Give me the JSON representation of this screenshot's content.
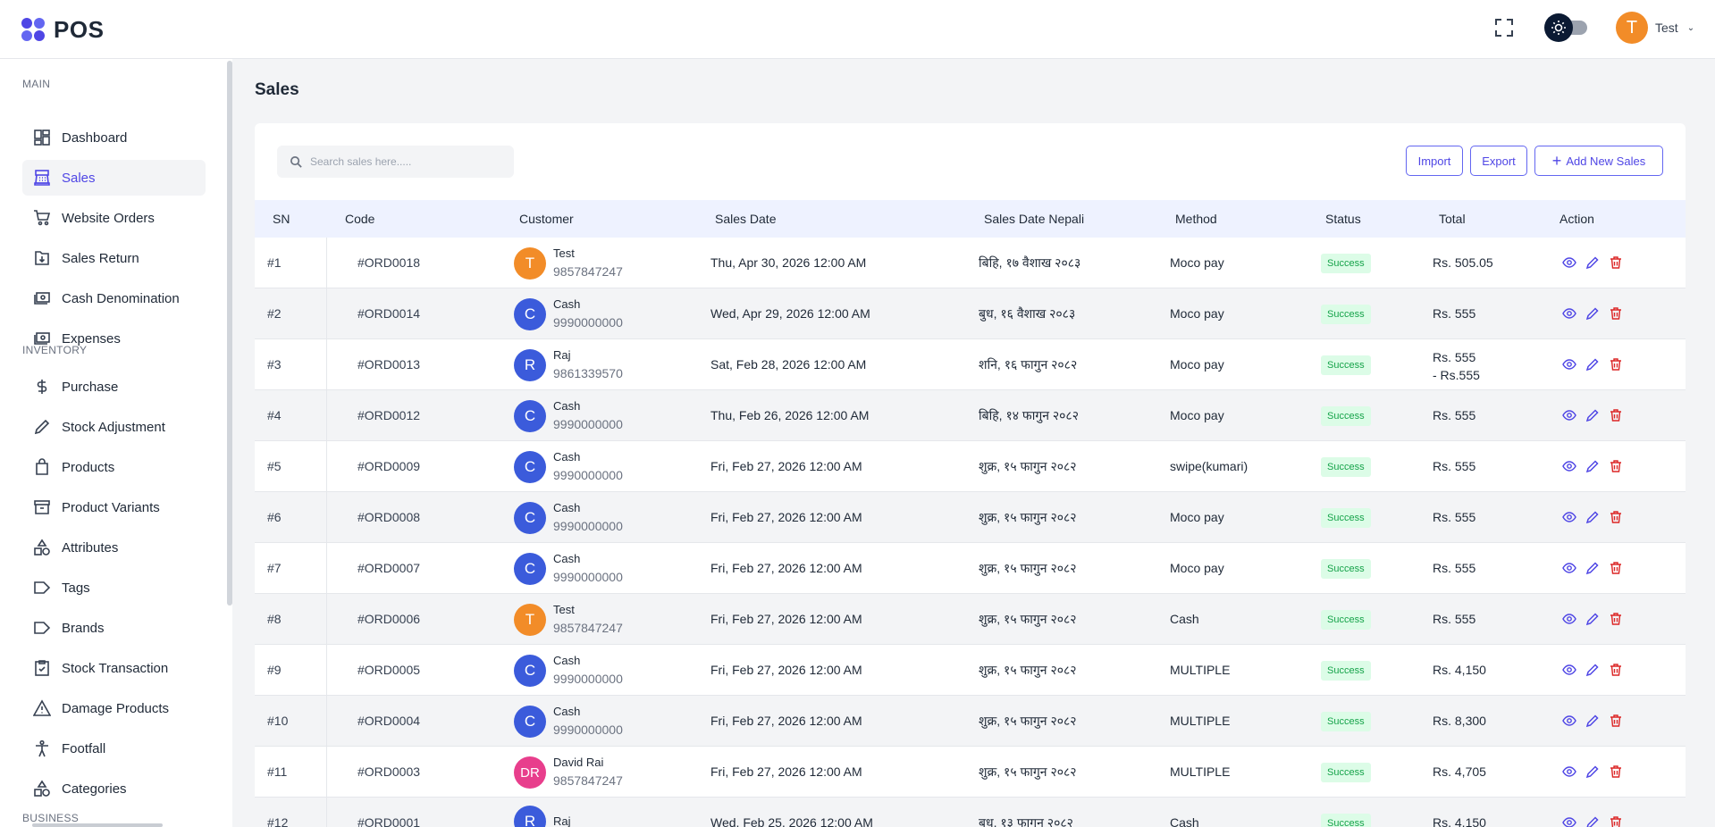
{
  "header": {
    "logo_text": "POS",
    "user_initial": "T",
    "user_name": "Test"
  },
  "sidebar": {
    "sections": {
      "main": "MAIN",
      "inventory": "INVENTORY",
      "business": "BUSINESS"
    },
    "items": [
      {
        "label": "Dashboard",
        "icon": "dashboard-icon"
      },
      {
        "label": "Sales",
        "icon": "cash-register-icon",
        "active": true
      },
      {
        "label": "Website Orders",
        "icon": "cart-icon"
      },
      {
        "label": "Sales Return",
        "icon": "return-box-icon"
      },
      {
        "label": "Cash Denomination",
        "icon": "banknote-icon"
      },
      {
        "label": "Expenses",
        "icon": "banknote-icon"
      },
      {
        "label": "Purchase",
        "icon": "dollar-icon"
      },
      {
        "label": "Stock Adjustment",
        "icon": "pencil-icon"
      },
      {
        "label": "Products",
        "icon": "shopping-bag-icon"
      },
      {
        "label": "Product Variants",
        "icon": "archive-icon"
      },
      {
        "label": "Attributes",
        "icon": "shapes-icon"
      },
      {
        "label": "Tags",
        "icon": "tag-icon"
      },
      {
        "label": "Brands",
        "icon": "tag-icon"
      },
      {
        "label": "Stock Transaction",
        "icon": "clipboard-check-icon"
      },
      {
        "label": "Damage Products",
        "icon": "warning-icon"
      },
      {
        "label": "Footfall",
        "icon": "person-icon"
      },
      {
        "label": "Categories",
        "icon": "shapes-icon"
      }
    ]
  },
  "main": {
    "title": "Sales",
    "search_placeholder": "Search sales here.....",
    "buttons": {
      "import": "Import",
      "export": "Export",
      "add": "Add New Sales"
    },
    "columns": [
      "SN",
      "Code",
      "Customer",
      "Sales Date",
      "Sales Date Nepali",
      "Method",
      "Status",
      "Total",
      "Action"
    ],
    "rows": [
      {
        "sn": "#1",
        "code": "#ORD0018",
        "initial": "T",
        "avatar_color": "#f28c28",
        "name": "Test",
        "phone": "9857847247",
        "date": "Thu, Apr 30, 2026 12:00 AM",
        "nepali": "बिहि, १७ वैशाख २०८३",
        "method": "Moco pay",
        "status": "Success",
        "total": "Rs. 505.05",
        "total2": ""
      },
      {
        "sn": "#2",
        "code": "#ORD0014",
        "initial": "C",
        "avatar_color": "#3b5bdb",
        "name": "Cash",
        "phone": "9990000000",
        "date": "Wed, Apr 29, 2026 12:00 AM",
        "nepali": "बुध, १६ वैशाख २०८३",
        "method": "Moco pay",
        "status": "Success",
        "total": "Rs. 555",
        "total2": ""
      },
      {
        "sn": "#3",
        "code": "#ORD0013",
        "initial": "R",
        "avatar_color": "#3b5bdb",
        "name": "Raj",
        "phone": "9861339570",
        "date": "Sat, Feb 28, 2026 12:00 AM",
        "nepali": "शनि, १६ फागुन २०८२",
        "method": "Moco pay",
        "status": "Success",
        "total": "Rs. 555",
        "total2": "- Rs.555"
      },
      {
        "sn": "#4",
        "code": "#ORD0012",
        "initial": "C",
        "avatar_color": "#3b5bdb",
        "name": "Cash",
        "phone": "9990000000",
        "date": "Thu, Feb 26, 2026 12:00 AM",
        "nepali": "बिहि, १४ फागुन २०८२",
        "method": "Moco pay",
        "status": "Success",
        "total": "Rs. 555",
        "total2": ""
      },
      {
        "sn": "#5",
        "code": "#ORD0009",
        "initial": "C",
        "avatar_color": "#3b5bdb",
        "name": "Cash",
        "phone": "9990000000",
        "date": "Fri, Feb 27, 2026 12:00 AM",
        "nepali": "शुक्र, १५ फागुन २०८२",
        "method": "swipe(kumari)",
        "status": "Success",
        "total": "Rs. 555",
        "total2": ""
      },
      {
        "sn": "#6",
        "code": "#ORD0008",
        "initial": "C",
        "avatar_color": "#3b5bdb",
        "name": "Cash",
        "phone": "9990000000",
        "date": "Fri, Feb 27, 2026 12:00 AM",
        "nepali": "शुक्र, १५ फागुन २०८२",
        "method": "Moco pay",
        "status": "Success",
        "total": "Rs. 555",
        "total2": ""
      },
      {
        "sn": "#7",
        "code": "#ORD0007",
        "initial": "C",
        "avatar_color": "#3b5bdb",
        "name": "Cash",
        "phone": "9990000000",
        "date": "Fri, Feb 27, 2026 12:00 AM",
        "nepali": "शुक्र, १५ फागुन २०८२",
        "method": "Moco pay",
        "status": "Success",
        "total": "Rs. 555",
        "total2": ""
      },
      {
        "sn": "#8",
        "code": "#ORD0006",
        "initial": "T",
        "avatar_color": "#f28c28",
        "name": "Test",
        "phone": "9857847247",
        "date": "Fri, Feb 27, 2026 12:00 AM",
        "nepali": "शुक्र, १५ फागुन २०८२",
        "method": "Cash",
        "status": "Success",
        "total": "Rs. 555",
        "total2": ""
      },
      {
        "sn": "#9",
        "code": "#ORD0005",
        "initial": "C",
        "avatar_color": "#3b5bdb",
        "name": "Cash",
        "phone": "9990000000",
        "date": "Fri, Feb 27, 2026 12:00 AM",
        "nepali": "शुक्र, १५ फागुन २०८२",
        "method": "MULTIPLE",
        "status": "Success",
        "total": "Rs. 4,150",
        "total2": ""
      },
      {
        "sn": "#10",
        "code": "#ORD0004",
        "initial": "C",
        "avatar_color": "#3b5bdb",
        "name": "Cash",
        "phone": "9990000000",
        "date": "Fri, Feb 27, 2026 12:00 AM",
        "nepali": "शुक्र, १५ फागुन २०८२",
        "method": "MULTIPLE",
        "status": "Success",
        "total": "Rs. 8,300",
        "total2": ""
      },
      {
        "sn": "#11",
        "code": "#ORD0003",
        "initial": "DR",
        "avatar_color": "#e83e8c",
        "name": "David Rai",
        "phone": "9857847247",
        "date": "Fri, Feb 27, 2026 12:00 AM",
        "nepali": "शुक्र, १५ फागुन २०८२",
        "method": "MULTIPLE",
        "status": "Success",
        "total": "Rs. 4,705",
        "total2": ""
      },
      {
        "sn": "#12",
        "code": "#ORD0001",
        "initial": "R",
        "avatar_color": "#3b5bdb",
        "name": "Raj",
        "phone": "",
        "date": "Wed, Feb 25, 2026 12:00 AM",
        "nepali": "बुध, १३ फागुन २०८२",
        "method": "Cash",
        "status": "Success",
        "total": "Rs. 4,150",
        "total2": ""
      }
    ]
  },
  "colors": {
    "accent": "#4f46e5",
    "success_bg": "#dcfce7",
    "success_text": "#16a34a",
    "edit_icon": "#4f46e5",
    "delete_icon": "#dc2626"
  }
}
